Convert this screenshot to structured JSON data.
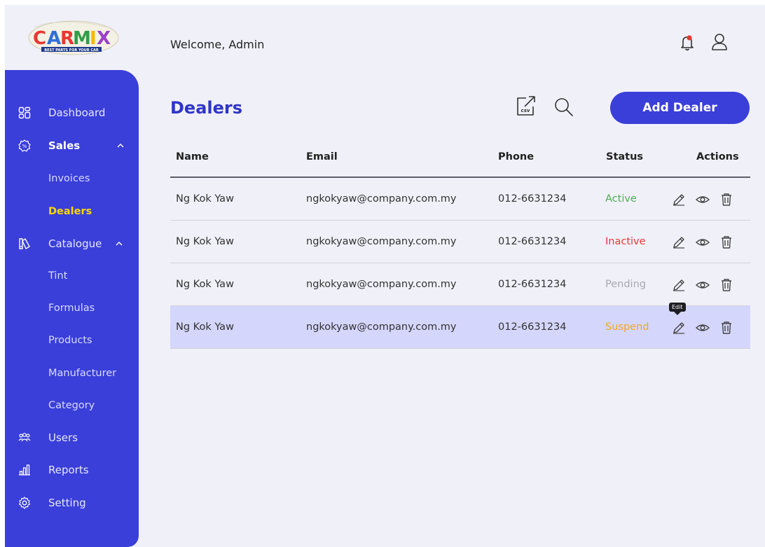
{
  "header": {
    "welcome": "Welcome, Admin"
  },
  "logo": {
    "text": "CARMIX",
    "tagline": "BEST PARTS FOR YOUR CAR"
  },
  "sidebar": {
    "items": [
      {
        "label": "Dashboard"
      },
      {
        "label": "Sales"
      },
      {
        "label": "Catalogue"
      },
      {
        "label": "Users"
      },
      {
        "label": "Reports"
      },
      {
        "label": "Setting"
      }
    ],
    "sales_sub": [
      {
        "label": "Invoices"
      },
      {
        "label": "Dealers"
      }
    ],
    "catalogue_sub": [
      {
        "label": "Tint"
      },
      {
        "label": "Formulas"
      },
      {
        "label": "Products"
      },
      {
        "label": "Manufacturer"
      },
      {
        "label": "Category"
      }
    ]
  },
  "page": {
    "title": "Dealers",
    "add_button": "Add Dealer",
    "csv_label": "csv"
  },
  "table": {
    "columns": [
      "Name",
      "Email",
      "Phone",
      "Status",
      "Actions"
    ],
    "rows": [
      {
        "name": "Ng Kok Yaw",
        "email": "ngkokyaw@company.com.my",
        "phone": "012-6631234",
        "status": "Active"
      },
      {
        "name": "Ng Kok Yaw",
        "email": "ngkokyaw@company.com.my",
        "phone": "012-6631234",
        "status": "Inactive"
      },
      {
        "name": "Ng Kok Yaw",
        "email": "ngkokyaw@company.com.my",
        "phone": "012-6631234",
        "status": "Pending"
      },
      {
        "name": "Ng Kok Yaw",
        "email": "ngkokyaw@company.com.my",
        "phone": "012-6631234",
        "status": "Suspend"
      }
    ],
    "tooltip": "Edit"
  },
  "colors": {
    "brand": "#3a3fd9",
    "active": "#4caf50",
    "inactive": "#e53935",
    "pending": "#a8a8b0",
    "suspend": "#f5a623",
    "highlight_row": "#d4d6fb",
    "notification_dot": "#e53935"
  },
  "icons": [
    "dashboard-icon",
    "sales-icon",
    "catalogue-icon",
    "users-icon",
    "reports-icon",
    "setting-icon",
    "bell-icon",
    "user-icon",
    "csv-export-icon",
    "search-icon",
    "edit-icon",
    "view-icon",
    "delete-icon"
  ]
}
